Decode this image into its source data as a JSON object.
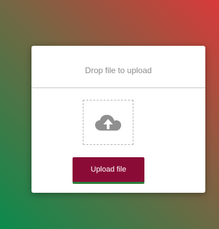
{
  "upload_card": {
    "title": "Drop file to upload",
    "drop_zone_icon": "cloud-upload-icon",
    "button_label": "Upload file"
  },
  "colors": {
    "button_background": "#8b0b37",
    "button_underline": "#2e7d3a",
    "gradient_start": "#0c8b4c",
    "gradient_end": "#d83a3a"
  }
}
